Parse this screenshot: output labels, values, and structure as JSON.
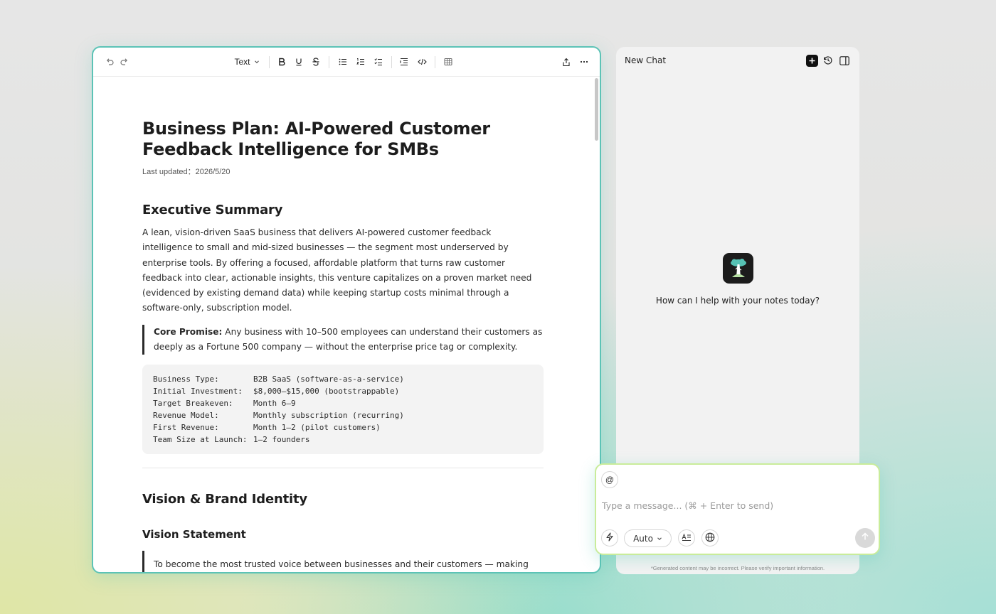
{
  "toolbar": {
    "text_style_label": "Text"
  },
  "document": {
    "title": "Business Plan: AI-Powered Customer Feedback Intelligence for SMBs",
    "last_updated": "Last updated：2026/5/20",
    "executive_summary": {
      "heading": "Executive Summary",
      "body": "A lean, vision-driven SaaS business that delivers AI-powered customer feedback intelligence to small and mid-sized businesses — the segment most underserved by enterprise tools. By offering a focused, affordable platform that turns raw customer feedback into clear, actionable insights, this venture capitalizes on a proven market need (evidenced by existing demand data) while keeping startup costs minimal through a software-only, subscription model.",
      "promise_label": "Core Promise:",
      "promise_text": " Any business with 10–500 employees can understand their customers as deeply as a Fortune 500 company — without the enterprise price tag or complexity."
    },
    "facts": [
      {
        "key": "Business Type:",
        "value": "B2B SaaS (software-as-a-service)"
      },
      {
        "key": "Initial Investment:",
        "value": "$8,000–$15,000 (bootstrappable)"
      },
      {
        "key": "Target Breakeven:",
        "value": "Month 6–9"
      },
      {
        "key": "Revenue Model:",
        "value": "Monthly subscription (recurring)"
      },
      {
        "key": "First Revenue:",
        "value": "Month 1–2 (pilot customers)"
      },
      {
        "key": "Team Size at Launch:",
        "value": "1–2 founders"
      }
    ],
    "vision": {
      "heading": "Vision & Brand Identity",
      "subheading": "Vision Statement",
      "quote": "To become the most trusted voice between businesses and their customers — making"
    }
  },
  "chat": {
    "title": "New Chat",
    "greeting": "How can I help with your notes today?",
    "composer": {
      "mention_symbol": "@",
      "placeholder": "Type a message... (⌘ + Enter to send)",
      "model_selected": "Auto"
    },
    "disclaimer": "*Generated content may be incorrect. Please verify important information."
  }
}
